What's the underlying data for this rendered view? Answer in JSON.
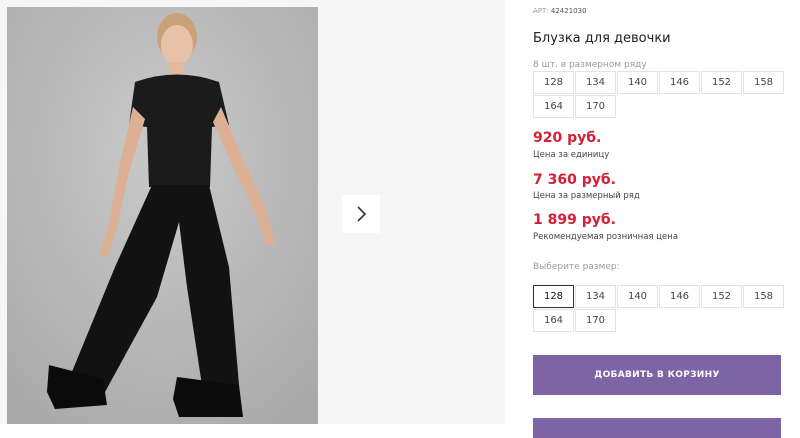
{
  "product": {
    "sku_label": "АРТ:",
    "sku": "42421030",
    "title": "Блузка для девочки",
    "pack_note": "8 шт. в размерном ряду",
    "pack_sizes": [
      "128",
      "134",
      "140",
      "146",
      "152",
      "158",
      "164",
      "170"
    ],
    "prices": [
      {
        "value": "920 руб.",
        "label": "Цена за единицу"
      },
      {
        "value": "7 360 руб.",
        "label": "Цена за размерный ряд"
      },
      {
        "value": "1 899 руб.",
        "label": "Рекомендуемая розничная цена"
      }
    ],
    "choose_size_label": "Выберите размер:",
    "size_options": [
      "128",
      "134",
      "140",
      "146",
      "152",
      "158",
      "164",
      "170"
    ],
    "selected_size": "128",
    "add_to_cart_label": "ДОБАВИТЬ В КОРЗИНУ"
  },
  "gallery": {
    "next_icon": "chevron-right-icon"
  },
  "colors": {
    "price": "#d81e34",
    "button": "#7d64a5"
  }
}
